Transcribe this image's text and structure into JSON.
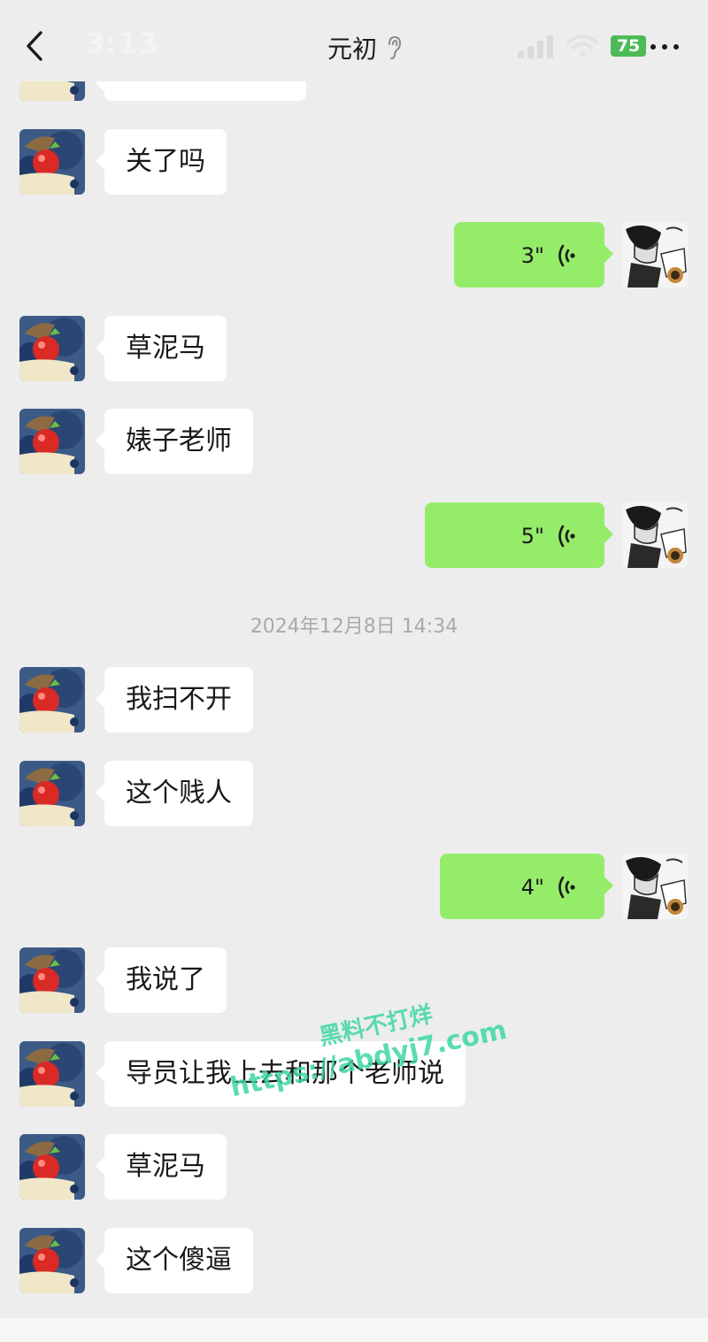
{
  "status_bar": {
    "time": "3:13",
    "battery": "75"
  },
  "header": {
    "title": "元初"
  },
  "messages": [
    {
      "text": "关了吗"
    },
    {
      "duration": "3\""
    },
    {
      "text": "草泥马"
    },
    {
      "text": "婊子老师"
    },
    {
      "duration": "5\""
    },
    {
      "text": "我扫不开"
    },
    {
      "text": "这个贱人"
    },
    {
      "duration": "4\""
    },
    {
      "text": "我说了"
    },
    {
      "text": "导员让我上去和那个老师说"
    },
    {
      "text": "草泥马"
    },
    {
      "text": "这个傻逼"
    }
  ],
  "timestamp": "2024年12月8日 14:34",
  "watermark": {
    "line1": "黑料不打烊",
    "line2": "https://abdyj7.com"
  },
  "colors": {
    "background": "#ededed",
    "incoming_bubble": "#ffffff",
    "outgoing_bubble": "#95ec69",
    "battery": "#4cbb57"
  },
  "icons": [
    "back-arrow-icon",
    "hearing-icon",
    "signal-icon",
    "wifi-icon",
    "more-icon",
    "voice-wave-icon"
  ]
}
